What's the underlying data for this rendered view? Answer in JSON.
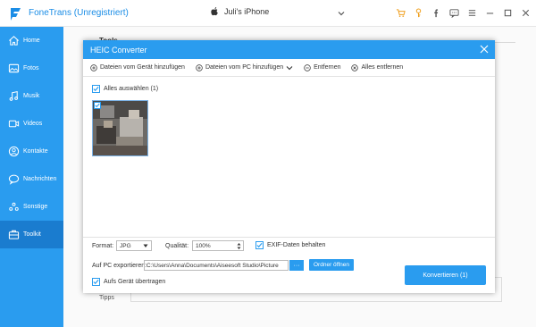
{
  "app": {
    "title": "FoneTrans (Unregistriert)",
    "device_name": "Juli's iPhone",
    "accent": "#2a9cef"
  },
  "titlebar_icons": [
    "cart-icon",
    "key-icon",
    "facebook-icon",
    "chat-icon",
    "menu-icon",
    "minimize-icon",
    "maximize-icon",
    "close-icon"
  ],
  "sidebar": {
    "items": [
      {
        "label": "Home",
        "icon": "home-icon"
      },
      {
        "label": "Fotos",
        "icon": "photo-icon"
      },
      {
        "label": "Musik",
        "icon": "music-icon"
      },
      {
        "label": "Videos",
        "icon": "video-icon"
      },
      {
        "label": "Kontakte",
        "icon": "contact-icon"
      },
      {
        "label": "Nachrichten",
        "icon": "message-icon"
      },
      {
        "label": "Sonstige",
        "icon": "other-icon"
      },
      {
        "label": "Toolkit",
        "icon": "toolkit-icon",
        "active": true
      }
    ]
  },
  "background": {
    "tools_label": "Tools",
    "tipps_label": "Tipps"
  },
  "dialog": {
    "title": "HEIC Converter",
    "toolbar": {
      "add_from_device": "Dateien vom Gerät hinzufügen",
      "add_from_pc": "Dateien vom PC hinzufügen",
      "remove": "Entfernen",
      "remove_all": "Alles entfernen"
    },
    "select_all_label": "Alles auswählen (1)",
    "format_label": "Format:",
    "format_value": "JPG",
    "quality_label": "Qualität:",
    "quality_value": "100%",
    "exif_label": "EXIF-Daten behalten",
    "export_label": "Auf PC exportieren:",
    "export_path": "C:\\Users\\Anna\\Documents\\Aiseesoft Studio\\Picture",
    "browse_label": "···",
    "open_folder_label": "Ordner öffnen",
    "transfer_label": "Aufs Gerät übertragen",
    "convert_label": "Konvertieren (1)"
  }
}
